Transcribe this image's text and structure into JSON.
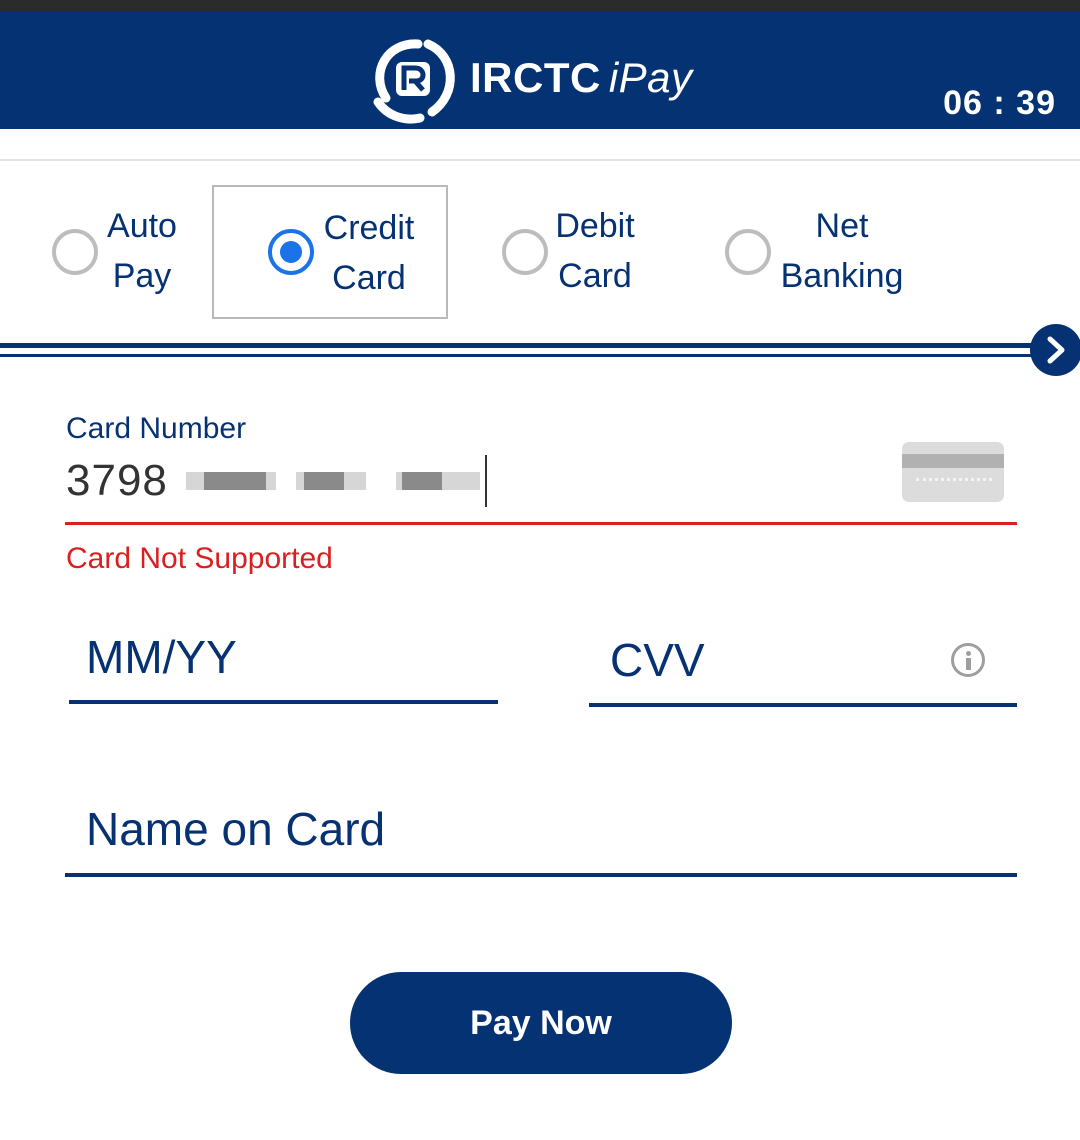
{
  "header": {
    "brand_name": "IRCTC",
    "brand_suffix": "iPay",
    "timer": "06 : 39",
    "logo_icon": "irctc-logo-icon"
  },
  "payment_tabs": [
    {
      "line1": "Auto",
      "line2": "Pay",
      "selected": false
    },
    {
      "line1": "Credit",
      "line2": "Card",
      "selected": true
    },
    {
      "line1": "Debit",
      "line2": "Card",
      "selected": false
    },
    {
      "line1": "Net",
      "line2": "Banking",
      "selected": false
    }
  ],
  "next_icon": "chevron-right-icon",
  "card_form": {
    "card_number_label": "Card Number",
    "card_number_value": "3798",
    "card_error": "Card Not Supported",
    "expiry_placeholder": "MM/YY",
    "cvv_placeholder": "CVV",
    "name_placeholder": "Name on Card"
  },
  "pay_button": "Pay Now",
  "colors": {
    "brand_navy": "#043272",
    "radio_selected": "#1a73e8",
    "error_red": "#d91f1f"
  }
}
